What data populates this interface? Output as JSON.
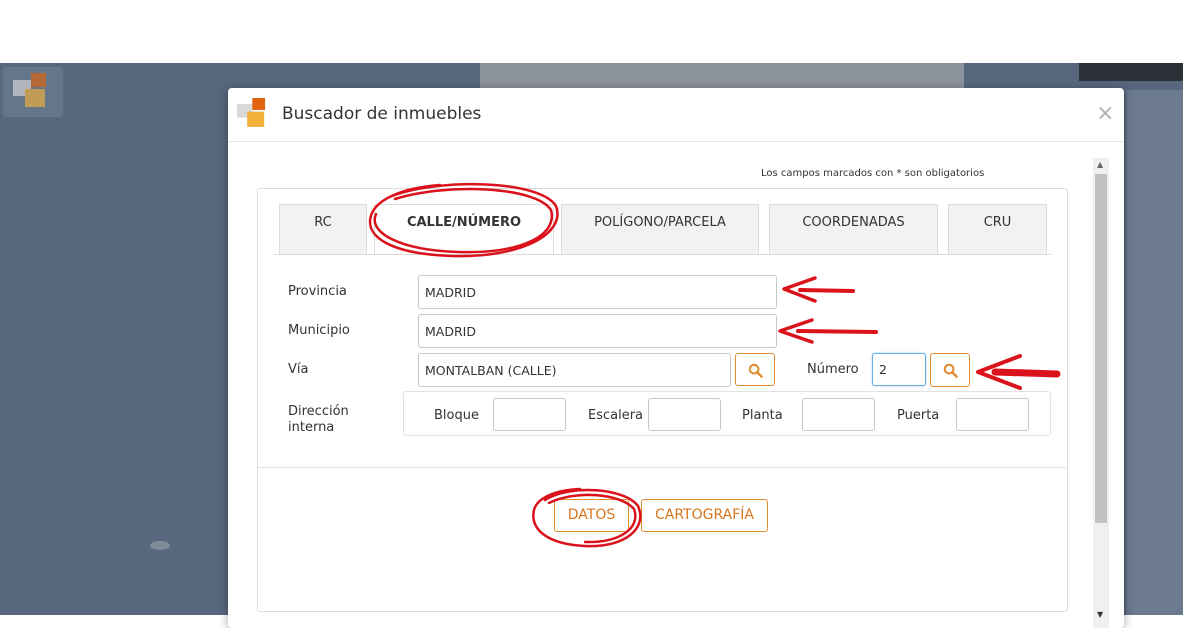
{
  "dialog": {
    "title": "Buscador de inmuebles",
    "close_label": "×",
    "required_note": "Los campos marcados con * son obligatorios"
  },
  "tabs": [
    {
      "label": "RC",
      "active": false
    },
    {
      "label": "CALLE/NÚMERO",
      "active": true
    },
    {
      "label": "POLÍGONO/PARCELA",
      "active": false
    },
    {
      "label": "COORDENADAS",
      "active": false
    },
    {
      "label": "CRU",
      "active": false
    }
  ],
  "form": {
    "provincia": {
      "label": "Provincia",
      "value": "MADRID"
    },
    "municipio": {
      "label": "Municipio",
      "value": "MADRID"
    },
    "via": {
      "label": "Vía",
      "value": "MONTALBAN (CALLE)"
    },
    "numero": {
      "label": "Número",
      "value": "2"
    },
    "direccion_interna": {
      "label_line1": "Dirección",
      "label_line2": "interna",
      "bloque": {
        "label": "Bloque",
        "value": ""
      },
      "escalera": {
        "label": "Escalera",
        "value": ""
      },
      "planta": {
        "label": "Planta",
        "value": ""
      },
      "puerta": {
        "label": "Puerta",
        "value": ""
      }
    }
  },
  "actions": {
    "datos": "DATOS",
    "cartografia": "CARTOGRAFÍA"
  },
  "colors": {
    "accent": "#e08c33",
    "accent_text": "#d9761c",
    "annotation": "#d9121b",
    "map_background": "#57677d"
  },
  "icons": {
    "search": "search-icon",
    "close": "close-icon",
    "logo": "catastro-logo-icon"
  }
}
